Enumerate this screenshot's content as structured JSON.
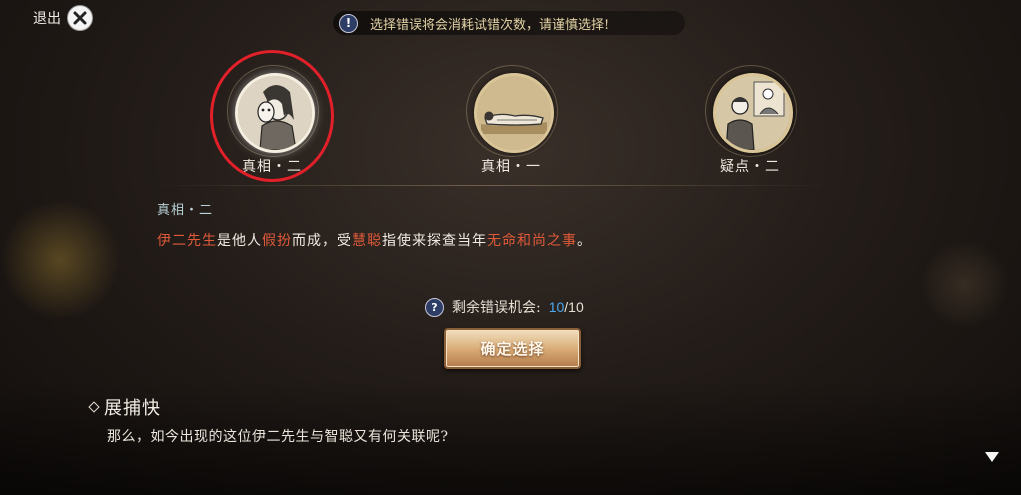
{
  "exit": {
    "label": "退出"
  },
  "warning": {
    "text": "选择错误将会消耗试错次数，请谨慎选择!"
  },
  "clues": [
    {
      "label": "真相・二",
      "icon": "masked-woman-portrait-icon",
      "selected": true
    },
    {
      "label": "真相・一",
      "icon": "lying-figure-icon",
      "selected": false
    },
    {
      "label": "疑点・二",
      "icon": "scholar-scene-icon",
      "selected": false
    }
  ],
  "detail": {
    "title": "真相・二",
    "segments": [
      {
        "text": "伊二先生",
        "highlight": true
      },
      {
        "text": "是他人",
        "highlight": false
      },
      {
        "text": "假扮",
        "highlight": true
      },
      {
        "text": "而成，受",
        "highlight": false
      },
      {
        "text": "慧聪",
        "highlight": true
      },
      {
        "text": "指使来探查当年",
        "highlight": false
      },
      {
        "text": "无命和尚之事",
        "highlight": true
      },
      {
        "text": "。",
        "highlight": false
      }
    ]
  },
  "chances": {
    "label": "剩余错误机会:",
    "remaining": "10",
    "total": "/10"
  },
  "confirm": {
    "label": "确定选择"
  },
  "dialogue": {
    "speaker": "展捕快",
    "text": "那么，如今出现的这位伊二先生与智聪又有何关联呢?"
  },
  "colors": {
    "highlight": "#e05a3a",
    "accent_number": "#4aa8f0",
    "selection_ring": "#e2202a"
  }
}
